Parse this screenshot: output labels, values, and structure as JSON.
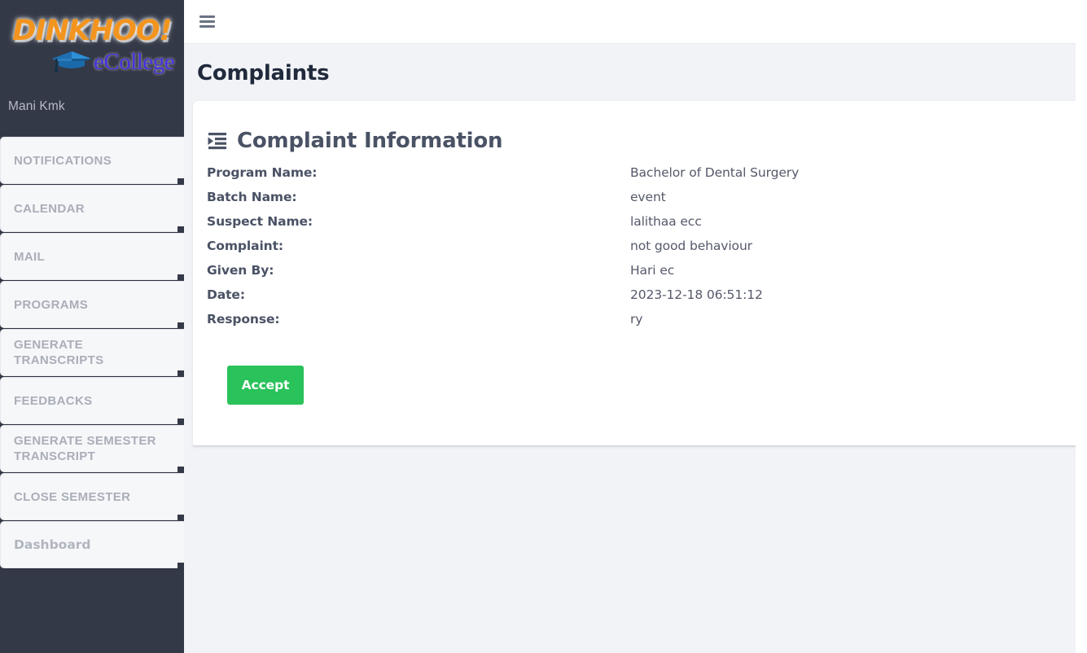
{
  "sidebar": {
    "logo": {
      "primary_text": "DINKHOO!",
      "secondary_text": "eCollege",
      "cap_icon": "graduation-cap-icon",
      "primary_color": "#F2941E",
      "secondary_color": "#4430dd"
    },
    "user_name": "Mani Kmk",
    "background_color": "#333947",
    "items": [
      {
        "label": "NOTIFICATIONS",
        "name": "notifications"
      },
      {
        "label": "CALENDAR",
        "name": "calendar"
      },
      {
        "label": "MAIL",
        "name": "mail"
      },
      {
        "label": "PROGRAMS",
        "name": "programs"
      },
      {
        "label": "GENERATE TRANSCRIPTS",
        "name": "generate-transcripts"
      },
      {
        "label": "FEEDBACKS",
        "name": "feedbacks"
      },
      {
        "label": "GENERATE SEMESTER TRANSCRIPT",
        "name": "generate-semester-transcript"
      },
      {
        "label": "CLOSE SEMESTER",
        "name": "close-semester"
      },
      {
        "label": "Dashboard",
        "name": "dashboard"
      }
    ]
  },
  "topbar": {
    "menu_toggle_icon": "hamburger-icon"
  },
  "page": {
    "title": "Complaints"
  },
  "card": {
    "section_icon": "indent-list-icon",
    "section_title": "Complaint Information",
    "rows": [
      {
        "label": "Program Name:",
        "value": "Bachelor of Dental Surgery"
      },
      {
        "label": "Batch Name:",
        "value": "event"
      },
      {
        "label": "Suspect Name:",
        "value": "lalithaa ecc"
      },
      {
        "label": "Complaint:",
        "value": "not good behaviour"
      },
      {
        "label": "Given By:",
        "value": "Hari ec"
      },
      {
        "label": "Date:",
        "value": "2023-12-18 06:51:12"
      },
      {
        "label": "Response:",
        "value": "ry"
      }
    ],
    "accept_label": "Accept",
    "accept_color": "#2ac25a"
  }
}
